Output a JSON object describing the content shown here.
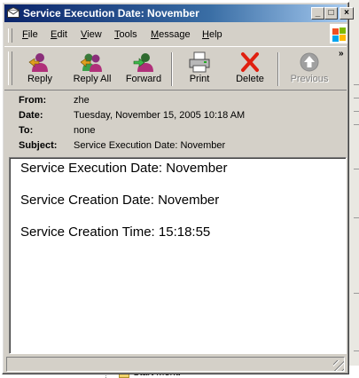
{
  "window": {
    "title": "Service Execution Date: November",
    "caption_buttons": {
      "minimize": "_",
      "maximize": "□",
      "close": "×"
    }
  },
  "menu": [
    {
      "label": "File",
      "accel": "F",
      "rest": "ile"
    },
    {
      "label": "Edit",
      "accel": "E",
      "rest": "dit"
    },
    {
      "label": "View",
      "accel": "V",
      "rest": "iew"
    },
    {
      "label": "Tools",
      "accel": "T",
      "rest": "ools"
    },
    {
      "label": "Message",
      "accel": "M",
      "rest": "essage"
    },
    {
      "label": "Help",
      "accel": "H",
      "rest": "elp"
    }
  ],
  "toolbar": {
    "reply": "Reply",
    "reply_all": "Reply All",
    "forward": "Forward",
    "print": "Print",
    "delete": "Delete",
    "previous": "Previous",
    "overflow": "»"
  },
  "message": {
    "labels": {
      "from": "From:",
      "date": "Date:",
      "to": "To:",
      "subject": "Subject:"
    },
    "from": "zhe",
    "date": "Tuesday, November 15, 2005 10:18 AM",
    "to": "none",
    "subject": "Service Execution Date: November",
    "body": [
      "Service Execution Date: November",
      "Service Creation Date: November",
      "Service Creation Time: 15:18:55"
    ]
  },
  "background": {
    "start_menu_label": "Start Menu"
  },
  "icons": {
    "title": "envelope-icon",
    "reply": "reply-icon",
    "reply_all": "reply-all-icon",
    "forward": "forward-icon",
    "print": "printer-icon",
    "delete": "delete-x-icon",
    "previous": "previous-arrow-icon",
    "brand": "windows-logo-icon"
  },
  "colors": {
    "title_start": "#0a246a",
    "title_end": "#a6caf0",
    "face": "#d4d0c8",
    "delete_red": "#e02010"
  }
}
